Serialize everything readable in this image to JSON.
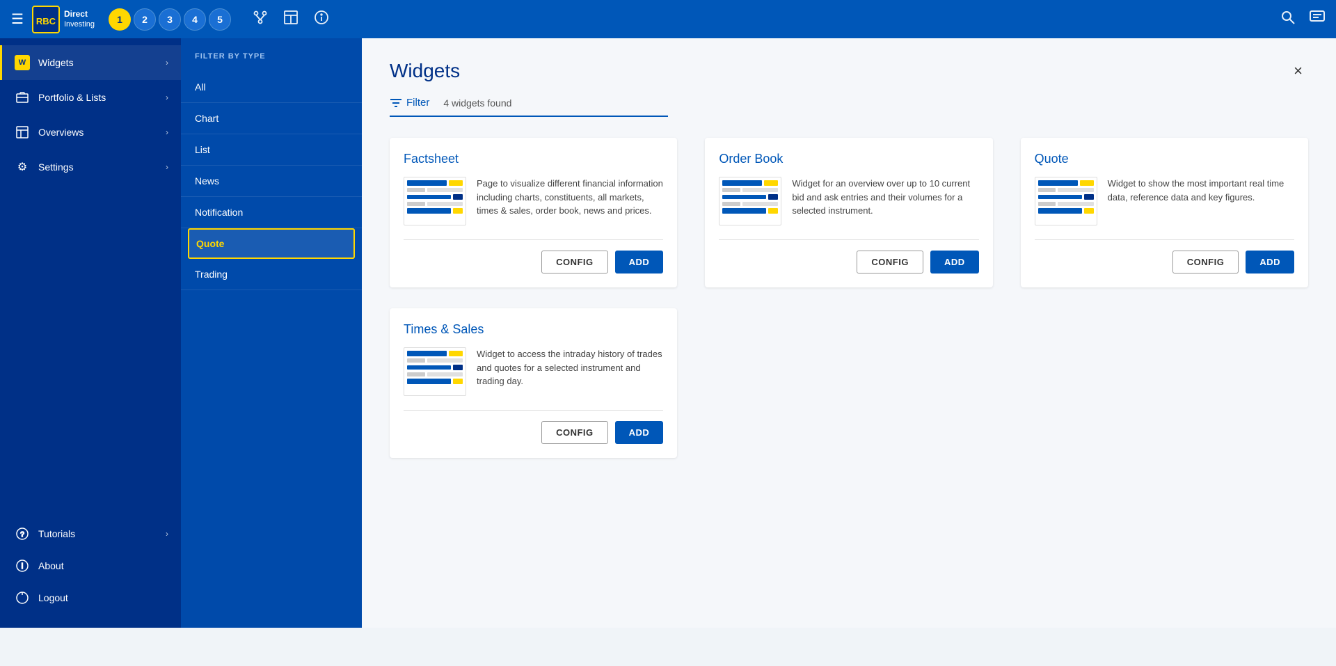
{
  "topNav": {
    "hamburger": "☰",
    "brandLine1": "Direct",
    "brandLine2": "Investing",
    "rbcLabel": "RBC",
    "tabs": [
      {
        "num": "1",
        "active": true
      },
      {
        "num": "2",
        "active": false
      },
      {
        "num": "3",
        "active": false
      },
      {
        "num": "4",
        "active": false
      },
      {
        "num": "5",
        "active": false
      }
    ],
    "searchIcon": "🔍",
    "chatIcon": "💬"
  },
  "sidebar": {
    "items": [
      {
        "label": "Widgets",
        "icon": "W",
        "active": true
      },
      {
        "label": "Portfolio & Lists",
        "icon": "📋",
        "active": false
      },
      {
        "label": "Overviews",
        "icon": "📄",
        "active": false
      },
      {
        "label": "Settings",
        "icon": "⚙",
        "active": false
      }
    ],
    "bottomItems": [
      {
        "label": "Tutorials",
        "icon": "❓"
      },
      {
        "label": "About",
        "icon": "ℹ"
      },
      {
        "label": "Logout",
        "icon": "⏻"
      }
    ]
  },
  "filterPanel": {
    "title": "FILTER BY TYPE",
    "items": [
      {
        "label": "All",
        "selected": false
      },
      {
        "label": "Chart",
        "selected": false
      },
      {
        "label": "List",
        "selected": false
      },
      {
        "label": "News",
        "selected": false
      },
      {
        "label": "Notification",
        "selected": false
      },
      {
        "label": "Quote",
        "selected": true
      },
      {
        "label": "Trading",
        "selected": false
      }
    ]
  },
  "mainPanel": {
    "title": "Widgets",
    "filterLabel": "Filter",
    "widgetsCount": "4 widgets found",
    "closeLabel": "×",
    "widgets": [
      {
        "id": "factsheet",
        "title": "Factsheet",
        "description": "Page to visualize different financial information including charts, constituents, all markets, times & sales, order book, news and prices.",
        "configLabel": "CONFIG",
        "addLabel": "ADD"
      },
      {
        "id": "orderbook",
        "title": "Order Book",
        "description": "Widget for an overview over up to 10 current bid and ask entries and their volumes for a selected instrument.",
        "configLabel": "CONFIG",
        "addLabel": "ADD"
      },
      {
        "id": "quote",
        "title": "Quote",
        "description": "Widget to show the most important real time data, reference data and key figures.",
        "configLabel": "CONFIG",
        "addLabel": "ADD"
      },
      {
        "id": "timessales",
        "title": "Times & Sales",
        "description": "Widget to access the intraday history of trades and quotes for a selected instrument and trading day.",
        "configLabel": "CONFIG",
        "addLabel": "ADD"
      }
    ]
  }
}
